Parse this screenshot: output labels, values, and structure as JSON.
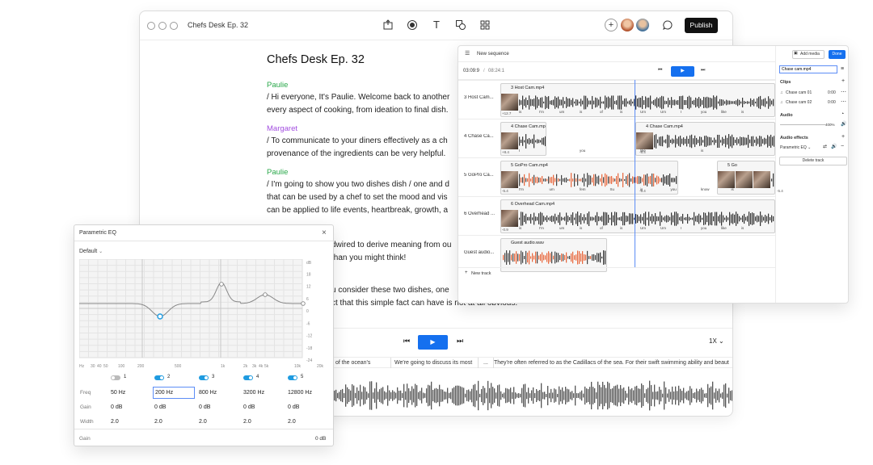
{
  "main_window": {
    "title": "Chefs Desk Ep. 32",
    "publish_label": "Publish",
    "doc_title": "Chefs Desk Ep. 32",
    "paragraphs": [
      {
        "speaker": "Paulie",
        "color": "#2aa84a",
        "lines": [
          "/ Hi everyone, It's Paulie. Welcome back to another",
          "every aspect of cooking, from ideation to final dish."
        ]
      },
      {
        "speaker": "Margaret",
        "color": "#a24de0",
        "lines": [
          "/ To communicate to your diners effectively as a ch",
          "provenance of the ingredients can be very helpful."
        ]
      },
      {
        "speaker": "Paulie",
        "color": "#2aa84a",
        "lines": [
          "/ I'm going to show you two dishes dish / one and d",
          "that can be used by a chef to set the mood and vis",
          "can be applied to life events, heartbreak, growth, a"
        ]
      }
    ],
    "frag1": "dwired to derive meaning from ou",
    "frag2": "than you might think!",
    "frag3": "u consider these two dishes, one",
    "frag4": "ct that this simple fact can have is not at all obvious.",
    "speed": "1X",
    "strip": [
      "of the ocean's",
      "We're going to discuss its most",
      "...",
      "They're often referred to as the Cadillacs of the sea. For their swift swimming ability and beaut"
    ]
  },
  "editor": {
    "sequence_title": "New sequence",
    "timecode": "03:09:9",
    "duration": "08:24:1",
    "add_media": "Add media",
    "done": "Done",
    "new_track": "New track",
    "tracks": [
      {
        "name": "3 Host Cam...",
        "clips": [
          "3 Host Cam.mp4"
        ],
        "words": [
          "is",
          "I'm",
          "um",
          "is",
          "of",
          "is",
          "Um",
          "Um",
          "I",
          "you",
          "like",
          "is"
        ]
      },
      {
        "name": "4 Chase Ca...",
        "clips": [
          "4 Chase Cam.mp",
          "4 Chase Cam.mp4"
        ],
        "words": [
          "I",
          "you",
          "like",
          "is"
        ]
      },
      {
        "name": "5 GoPro Ca...",
        "clips": [
          "5 GoPro Cam.mp4",
          "5 Go"
        ],
        "words": [
          "I'm",
          "um",
          "fem",
          "Su",
          "is",
          "you",
          "know",
          "is"
        ]
      },
      {
        "name": "6 Overhead ...",
        "clips": [
          "6 Overhead Cam.mp4"
        ],
        "words": [
          "is",
          "I'm",
          "um",
          "is",
          "of",
          "is",
          "Um",
          "Um",
          "I",
          "you",
          "like",
          "is"
        ]
      },
      {
        "name": "Guest audio...",
        "clips": [
          "Guest audio.wav"
        ],
        "words": []
      }
    ],
    "gains": [
      "+12.7",
      "+8.4",
      "-8.4",
      "-5.4",
      "-5.4",
      "-5.4",
      "-0.9"
    ],
    "panel": {
      "name_value": "Chase cam.mp4",
      "clips_label": "Clips",
      "clips": [
        {
          "name": "Chase cam 01",
          "time": "0:00"
        },
        {
          "name": "Chase cam 02",
          "time": "0:00"
        }
      ],
      "audio_label": "Audio",
      "audio_value": "400%",
      "effects_label": "Audio effects",
      "effect": "Parametric EQ",
      "delete": "Delete track"
    }
  },
  "eq": {
    "title": "Parametric EQ",
    "preset": "Default",
    "db_ticks": [
      "dB",
      "18",
      "12",
      "6",
      "0",
      "-6",
      "-12",
      "-18",
      "-24"
    ],
    "hz_ticks": [
      "Hz",
      "30",
      "40",
      "50",
      "100",
      "200",
      "500",
      "1k",
      "2k",
      "3k",
      "4k",
      "5k",
      "10k",
      "20k"
    ],
    "bands": [
      {
        "num": "1",
        "enabled": false,
        "freq": "50 Hz",
        "gain": "0 dB",
        "width": "2.0"
      },
      {
        "num": "2",
        "enabled": true,
        "freq": "200 Hz",
        "gain": "0 dB",
        "width": "2.0"
      },
      {
        "num": "3",
        "enabled": true,
        "freq": "800 Hz",
        "gain": "0 dB",
        "width": "2.0"
      },
      {
        "num": "4",
        "enabled": true,
        "freq": "3200 Hz",
        "gain": "0 dB",
        "width": "2.0"
      },
      {
        "num": "5",
        "enabled": true,
        "freq": "12800 Hz",
        "gain": "0 dB",
        "width": "2.0"
      }
    ],
    "row_labels": [
      "Freq",
      "Gain",
      "Width"
    ],
    "footer_label": "Gain",
    "footer_value": "0 dB",
    "accent": "#1f9be0"
  }
}
